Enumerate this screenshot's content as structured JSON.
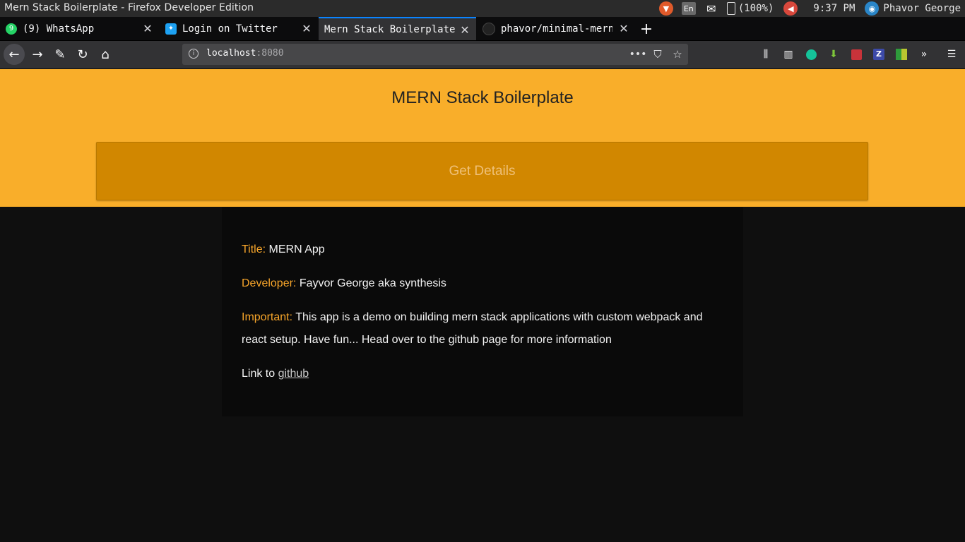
{
  "system": {
    "window_title": "Mern Stack Boilerplate - Firefox Developer Edition",
    "keyboard_layout": "En",
    "battery": "(100%)",
    "clock": "9:37 PM",
    "user": "Phavor George"
  },
  "tabs": [
    {
      "label": "(9) WhatsApp",
      "badge": "9",
      "icon": "whatsapp-icon"
    },
    {
      "label": "Login on Twitter",
      "icon": "twitter-icon"
    },
    {
      "label": "Mern Stack Boilerplate",
      "active": true
    },
    {
      "label": "phavor/minimal-mern-",
      "icon": "github-icon"
    }
  ],
  "address_bar": {
    "host": "localhost",
    "port": ":8080"
  },
  "page": {
    "title": "MERN Stack Boilerplate",
    "button_label": "Get Details",
    "details": {
      "title_label": "Title:",
      "title_value": "MERN App",
      "developer_label": "Developer:",
      "developer_value": "Fayvor George aka synthesis",
      "important_label": "Important:",
      "important_value": "This app is a demo on building mern stack applications with custom webpack and react setup. Have fun... Head over to the github page for more information",
      "link_prefix": "Link to",
      "link_text": "github"
    }
  },
  "colors": {
    "header_bg": "#f9ae2a",
    "button_bg": "#d18700",
    "label_accent": "#f7a52a",
    "page_bg": "#0f0f0f"
  }
}
